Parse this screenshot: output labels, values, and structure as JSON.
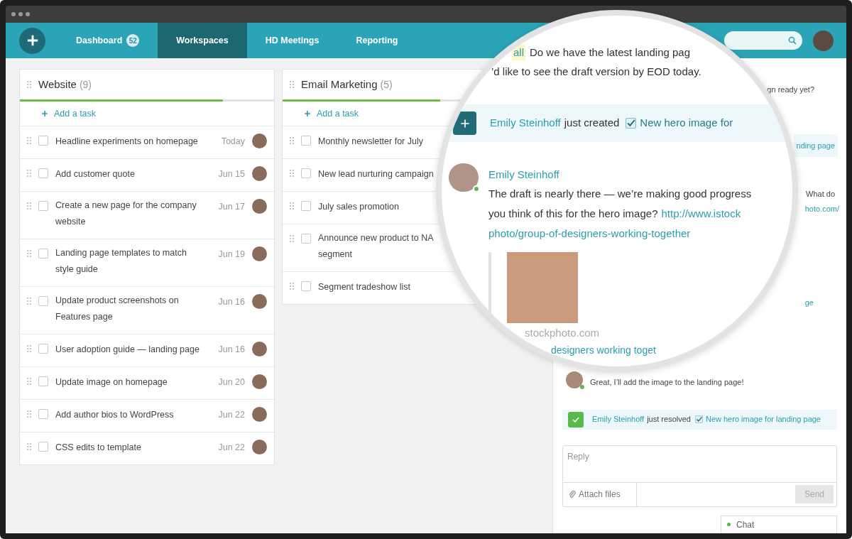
{
  "nav": {
    "tabs": [
      {
        "label": "Dashboard",
        "badge": "52",
        "selected": false
      },
      {
        "label": "Workspaces",
        "selected": true
      },
      {
        "label": "HD Meetings",
        "selected": false
      },
      {
        "label": "Reporting",
        "selected": false
      }
    ]
  },
  "columns": [
    {
      "title": "Website",
      "count": "(9)",
      "level": 0.8,
      "add_label": "Add a task",
      "tasks": [
        {
          "title": "Headline experiments on homepage",
          "date": "Today",
          "checked": false
        },
        {
          "title": "Add customer quote",
          "date": "Jun 15",
          "checked": false
        },
        {
          "title": "Create a new page for the company website",
          "date": "Jun 17",
          "checked": false
        },
        {
          "title": "Landing page templates to match style guide",
          "date": "Jun 19",
          "checked": false
        },
        {
          "title": "Update product screenshots on Features page",
          "date": "Jun 16",
          "checked": false
        },
        {
          "title": "User adoption guide — landing page",
          "date": "Jun 16",
          "checked": false
        },
        {
          "title": "Update image on homepage",
          "date": "Jun 20",
          "checked": false
        },
        {
          "title": "Add author bios to WordPress",
          "date": "Jun 22",
          "checked": false
        },
        {
          "title": "CSS edits to template",
          "date": "Jun 22",
          "checked": false
        }
      ]
    },
    {
      "title": "Email Marketing",
      "count": "(5)",
      "level": 0.62,
      "add_label": "Add a task",
      "tasks": [
        {
          "title": "Monthly newsletter for July",
          "checked": false
        },
        {
          "title": "New lead nurturing campaign",
          "checked": false
        },
        {
          "title": "July sales promotion",
          "checked": false
        },
        {
          "title": "Announce new product to NA segment",
          "checked": false
        },
        {
          "title": "Segment tradeshow list",
          "checked": false
        }
      ]
    }
  ],
  "activity": {
    "fragments": [
      {
        "text": "gn ready yet?",
        "kind": "text"
      },
      {
        "text": "nding page",
        "kind": "chip"
      },
      {
        "text": "What do",
        "kind": "text"
      },
      {
        "text": "hoto.com/",
        "kind": "link"
      },
      {
        "text": "ge",
        "kind": "link"
      }
    ],
    "message": {
      "text": "Great, I’ll add the image to the landing page!"
    },
    "event": {
      "user": "Emily Steinhoff",
      "action": "just resolved",
      "task": "New hero image for landing page"
    },
    "reply": {
      "placeholder": "Reply",
      "attach": "Attach files",
      "send": "Send"
    },
    "chat_tab": {
      "label": "Chat"
    }
  },
  "magnifier": {
    "mention": "all",
    "line_1": "Do we have the latest landing pag",
    "line_2": "’d like to see the draft version by EOD today.",
    "event": {
      "user": "Emily Steinhoff",
      "action": "just created",
      "task": "New hero image for"
    },
    "message": {
      "user": "Emily Steinhoff",
      "line_1": "The draft is nearly there — we’re making good progress",
      "line_2": "you think of this for the hero image?",
      "link_1": "http://www.istock",
      "link_2": "photo/group-of-designers-working-together"
    },
    "preview": {
      "source": "stockphoto.com",
      "title": "designers working toget"
    }
  }
}
